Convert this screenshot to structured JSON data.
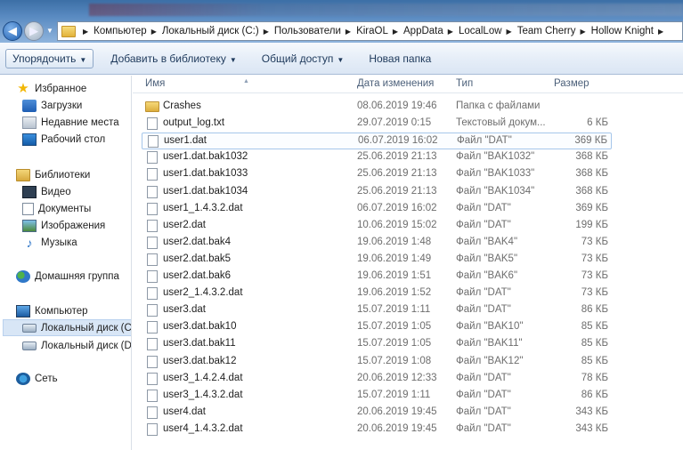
{
  "address": {
    "segments": [
      "Компьютер",
      "Локальный диск (C:)",
      "Пользователи",
      "KiraOL",
      "AppData",
      "LocalLow",
      "Team Cherry",
      "Hollow Knight"
    ]
  },
  "toolbar": {
    "organize": "Упорядочить",
    "add_to_library": "Добавить в библиотеку",
    "share": "Общий доступ",
    "new_folder": "Новая папка"
  },
  "nav": {
    "favorites": "Избранное",
    "downloads": "Загрузки",
    "recent": "Недавние места",
    "desktop": "Рабочий стол",
    "libraries": "Библиотеки",
    "video": "Видео",
    "documents": "Документы",
    "images": "Изображения",
    "music": "Музыка",
    "homegroup": "Домашняя группа",
    "computer": "Компьютер",
    "drive_c": "Локальный диск (C",
    "drive_d": "Локальный диск (D",
    "network": "Сеть"
  },
  "columns": {
    "name": "Имя",
    "date": "Дата изменения",
    "type": "Тип",
    "size": "Размер"
  },
  "files": [
    {
      "name": "Crashes",
      "date": "08.06.2019 19:46",
      "type": "Папка с файлами",
      "size": "",
      "kind": "folder"
    },
    {
      "name": "output_log.txt",
      "date": "29.07.2019 0:15",
      "type": "Текстовый докум...",
      "size": "6 КБ",
      "kind": "file"
    },
    {
      "name": "user1.dat",
      "date": "06.07.2019 16:02",
      "type": "Файл \"DAT\"",
      "size": "369 КБ",
      "kind": "file"
    },
    {
      "name": "user1.dat.bak1032",
      "date": "25.06.2019 21:13",
      "type": "Файл \"BAK1032\"",
      "size": "368 КБ",
      "kind": "file"
    },
    {
      "name": "user1.dat.bak1033",
      "date": "25.06.2019 21:13",
      "type": "Файл \"BAK1033\"",
      "size": "368 КБ",
      "kind": "file"
    },
    {
      "name": "user1.dat.bak1034",
      "date": "25.06.2019 21:13",
      "type": "Файл \"BAK1034\"",
      "size": "368 КБ",
      "kind": "file"
    },
    {
      "name": "user1_1.4.3.2.dat",
      "date": "06.07.2019 16:02",
      "type": "Файл \"DAT\"",
      "size": "369 КБ",
      "kind": "file"
    },
    {
      "name": "user2.dat",
      "date": "10.06.2019 15:02",
      "type": "Файл \"DAT\"",
      "size": "199 КБ",
      "kind": "file"
    },
    {
      "name": "user2.dat.bak4",
      "date": "19.06.2019 1:48",
      "type": "Файл \"BAK4\"",
      "size": "73 КБ",
      "kind": "file"
    },
    {
      "name": "user2.dat.bak5",
      "date": "19.06.2019 1:49",
      "type": "Файл \"BAK5\"",
      "size": "73 КБ",
      "kind": "file"
    },
    {
      "name": "user2.dat.bak6",
      "date": "19.06.2019 1:51",
      "type": "Файл \"BAK6\"",
      "size": "73 КБ",
      "kind": "file"
    },
    {
      "name": "user2_1.4.3.2.dat",
      "date": "19.06.2019 1:52",
      "type": "Файл \"DAT\"",
      "size": "73 КБ",
      "kind": "file"
    },
    {
      "name": "user3.dat",
      "date": "15.07.2019 1:11",
      "type": "Файл \"DAT\"",
      "size": "86 КБ",
      "kind": "file"
    },
    {
      "name": "user3.dat.bak10",
      "date": "15.07.2019 1:05",
      "type": "Файл \"BAK10\"",
      "size": "85 КБ",
      "kind": "file"
    },
    {
      "name": "user3.dat.bak11",
      "date": "15.07.2019 1:05",
      "type": "Файл \"BAK11\"",
      "size": "85 КБ",
      "kind": "file"
    },
    {
      "name": "user3.dat.bak12",
      "date": "15.07.2019 1:08",
      "type": "Файл \"BAK12\"",
      "size": "85 КБ",
      "kind": "file"
    },
    {
      "name": "user3_1.4.2.4.dat",
      "date": "20.06.2019 12:33",
      "type": "Файл \"DAT\"",
      "size": "78 КБ",
      "kind": "file"
    },
    {
      "name": "user3_1.4.3.2.dat",
      "date": "15.07.2019 1:11",
      "type": "Файл \"DAT\"",
      "size": "86 КБ",
      "kind": "file"
    },
    {
      "name": "user4.dat",
      "date": "20.06.2019 19:45",
      "type": "Файл \"DAT\"",
      "size": "343 КБ",
      "kind": "file"
    },
    {
      "name": "user4_1.4.3.2.dat",
      "date": "20.06.2019 19:45",
      "type": "Файл \"DAT\"",
      "size": "343 КБ",
      "kind": "file"
    }
  ],
  "selected_file_index": 2,
  "colors": {
    "title_gradient_top": "#3c6fa6",
    "toolbar_text": "#1e395b",
    "selection_border": "#a6c6ea",
    "nav_selected_bg": "#d8e6f6"
  }
}
